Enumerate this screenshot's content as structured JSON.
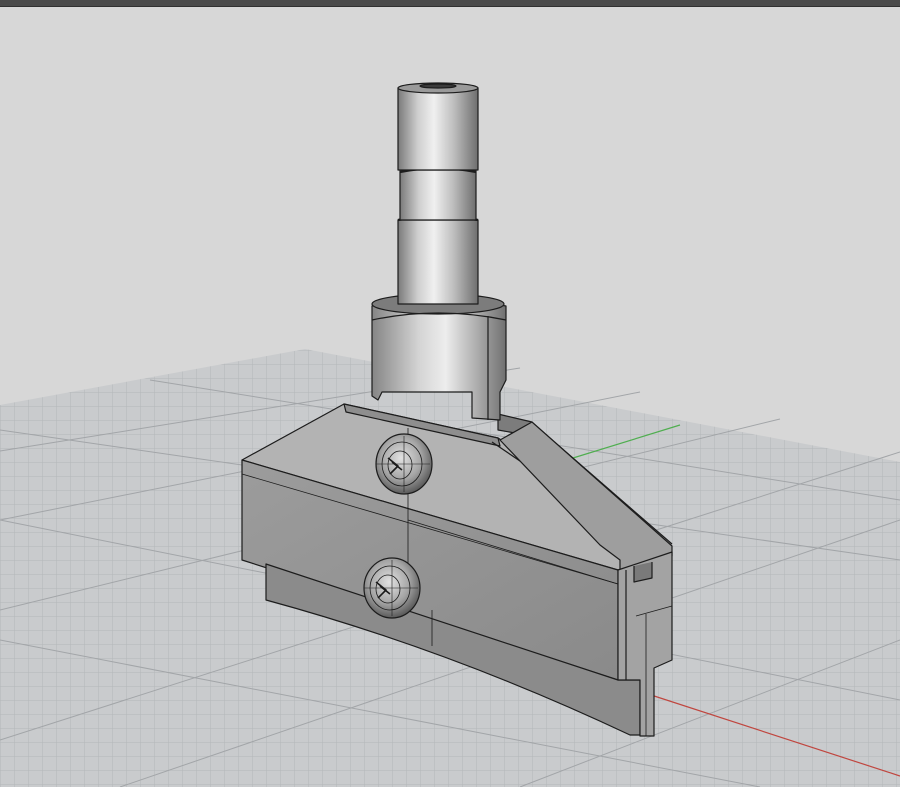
{
  "viewport": {
    "projection": "perspective",
    "display_mode": "shaded-with-wireframe",
    "background_color": "#d7d7d7",
    "grid_color": "#a9acae",
    "x_axis_color": "#c0463f",
    "y_axis_color": "#4fae4f"
  },
  "model": {
    "object_name": "connector-bracket-with-shaft",
    "screws_visible": 2,
    "shaft_segments": 3
  }
}
